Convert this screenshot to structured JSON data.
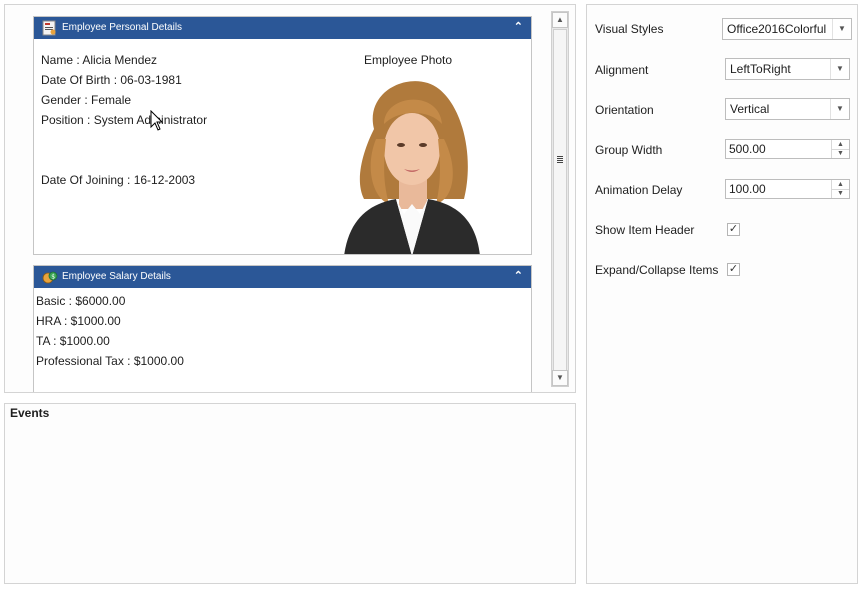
{
  "personal_group": {
    "title": "Employee Personal Details",
    "icon": "employee-card-icon",
    "name": "Name : Alicia Mendez",
    "dob": "Date Of Birth : 06-03-1981",
    "gender": "Gender : Female",
    "position": "Position : System Administrator",
    "joining": "Date Of Joining : 16-12-2003",
    "photo_label": "Employee Photo"
  },
  "salary_group": {
    "title": "Employee Salary Details",
    "icon": "money-icon",
    "basic": "Basic : $6000.00",
    "hra": "HRA : $1000.00",
    "ta": "TA : $1000.00",
    "tax": "Professional Tax : $1000.00"
  },
  "events": {
    "title": "Events"
  },
  "settings": {
    "visual_styles": {
      "label": "Visual Styles",
      "value": "Office2016Colorful"
    },
    "alignment": {
      "label": "Alignment",
      "value": "LeftToRight"
    },
    "orientation": {
      "label": "Orientation",
      "value": "Vertical"
    },
    "group_width": {
      "label": "Group Width",
      "value": "500.00"
    },
    "animation_delay": {
      "label": "Animation Delay",
      "value": "100.00"
    },
    "show_item_header": {
      "label": "Show Item Header",
      "checked": true
    },
    "expand_collapse": {
      "label": "Expand/Collapse Items",
      "checked": true
    }
  },
  "colors": {
    "header_blue": "#2b5797"
  }
}
